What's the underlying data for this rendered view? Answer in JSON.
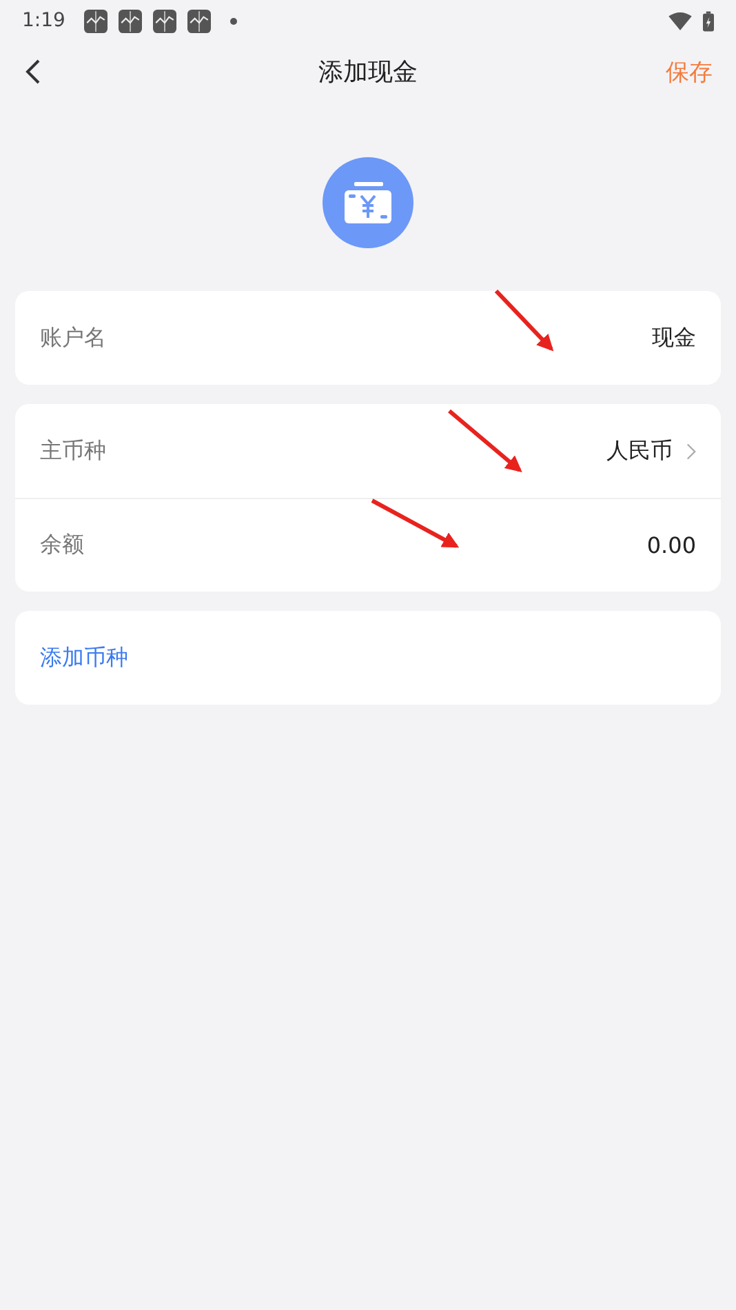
{
  "status_bar": {
    "time": "1:19"
  },
  "nav": {
    "title": "添加现金",
    "action": "保存"
  },
  "account": {
    "label": "账户名",
    "value": "现金"
  },
  "currency_rows": [
    {
      "kind": "select",
      "label": "主币种",
      "value": "人民币"
    },
    {
      "kind": "value",
      "label": "余额",
      "value": "0.00"
    }
  ],
  "add_currency": "添加币种"
}
